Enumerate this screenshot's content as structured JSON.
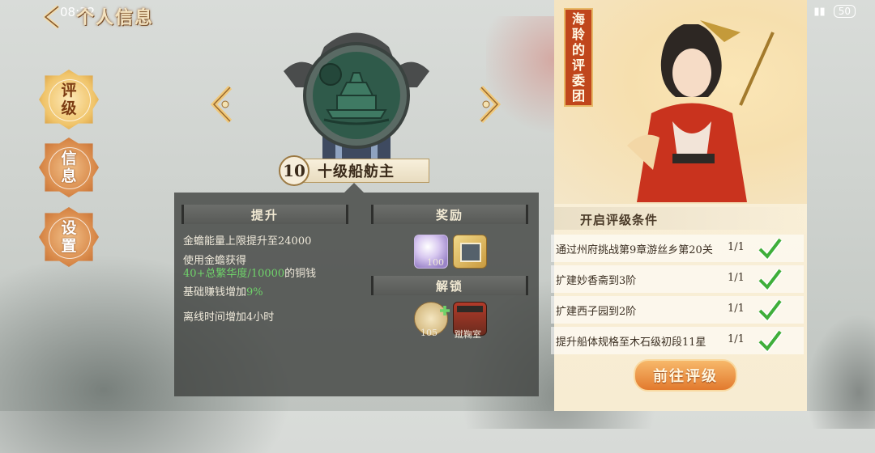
{
  "status_bar": {
    "time": "08:32",
    "battery": "50"
  },
  "header": {
    "title": "个人信息"
  },
  "side_nav": [
    {
      "label_top": "评",
      "label_bottom": "级"
    },
    {
      "label_top": "信",
      "label_bottom": "息"
    },
    {
      "label_top": "设",
      "label_bottom": "置"
    }
  ],
  "rank": {
    "level": "10",
    "name": "十级船舫主"
  },
  "upgrade": {
    "heading": "提升",
    "line1": "金蟾能量上限提升至24000",
    "line2": "使用金蟾获得",
    "line3_green": "40+总繁华度/10000",
    "line3_rest": "的铜钱",
    "line4_prefix": "基础赚钱增加",
    "line4_green": "9%",
    "line5": "离线时间增加4小时"
  },
  "reward": {
    "heading": "奖励",
    "item1_count": "100"
  },
  "unlock": {
    "heading": "解锁",
    "item1_count": "105",
    "item2_label": "蹴鞠室"
  },
  "committee": {
    "banner_text": [
      "海",
      "聆",
      "的",
      "评",
      "委",
      "团"
    ]
  },
  "conditions": {
    "title": "开启评级条件",
    "items": [
      {
        "text": "通过州府挑战第9章游丝乡第20关",
        "progress": "1/1"
      },
      {
        "text": "扩建妙香斋到3阶",
        "progress": "1/1"
      },
      {
        "text": "扩建西子园到2阶",
        "progress": "1/1"
      },
      {
        "text": "提升船体规格至木石级初段11星",
        "progress": "1/1"
      }
    ]
  },
  "go_button": {
    "label": "前往评级"
  },
  "colors": {
    "accent_orange": "#e27a2e",
    "check_green": "#3fae3a",
    "highlight_green": "#6fd36a"
  }
}
